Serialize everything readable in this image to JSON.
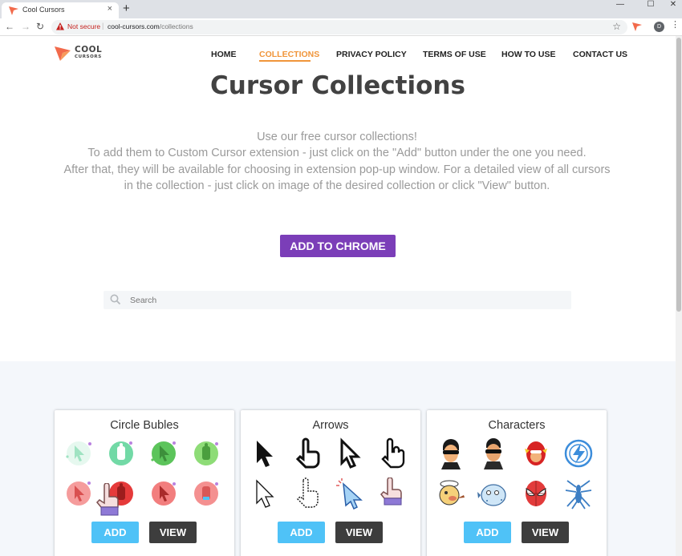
{
  "browser": {
    "tab_title": "Cool Cursors",
    "tab_close": "×",
    "new_tab": "+",
    "window": {
      "minimize": "—",
      "maximize": "☐",
      "close": "✕"
    },
    "nav": {
      "back": "←",
      "forward": "→",
      "reload": "↻"
    },
    "security_label": "Not secure",
    "url_separator": "|",
    "url_host": "cool-cursors.com",
    "url_path": "/collections",
    "bookmark_star": "☆",
    "profile_initial": "D",
    "menu": "⋮"
  },
  "site": {
    "logo_top": "COOL",
    "logo_bottom": "CURSORS",
    "accent_color": "#f0953a",
    "nav": [
      {
        "label": "HOME"
      },
      {
        "label": "COLLECTIONS",
        "active": true
      },
      {
        "label": "PRIVACY POLICY"
      },
      {
        "label": "TERMS OF USE"
      },
      {
        "label": "HOW TO USE"
      },
      {
        "label": "CONTACT US"
      }
    ]
  },
  "page": {
    "title": "Cursor Collections",
    "intro": [
      "Use our free cursor collections!",
      "To add them to Custom Cursor extension - just click on the \"Add\" button under the one you need.",
      "After that, they will be available for choosing in extension pop-up window. For a detailed view of all cursors",
      "in the collection - just click on image of the desired collection or click \"View\" button."
    ],
    "cta_label": "ADD TO CHROME",
    "cta_color": "#7b3eb8",
    "search_placeholder": "Search"
  },
  "collections": [
    {
      "title": "Circle Bubles",
      "add_label": "ADD",
      "view_label": "VIEW",
      "icons": [
        "circle-bubble-cursor-icons"
      ]
    },
    {
      "title": "Arrows",
      "add_label": "ADD",
      "view_label": "VIEW",
      "icons": [
        "arrow-cursor-icons"
      ]
    },
    {
      "title": "Characters",
      "add_label": "ADD",
      "view_label": "VIEW",
      "icons": [
        "character-cursor-icons"
      ]
    }
  ]
}
